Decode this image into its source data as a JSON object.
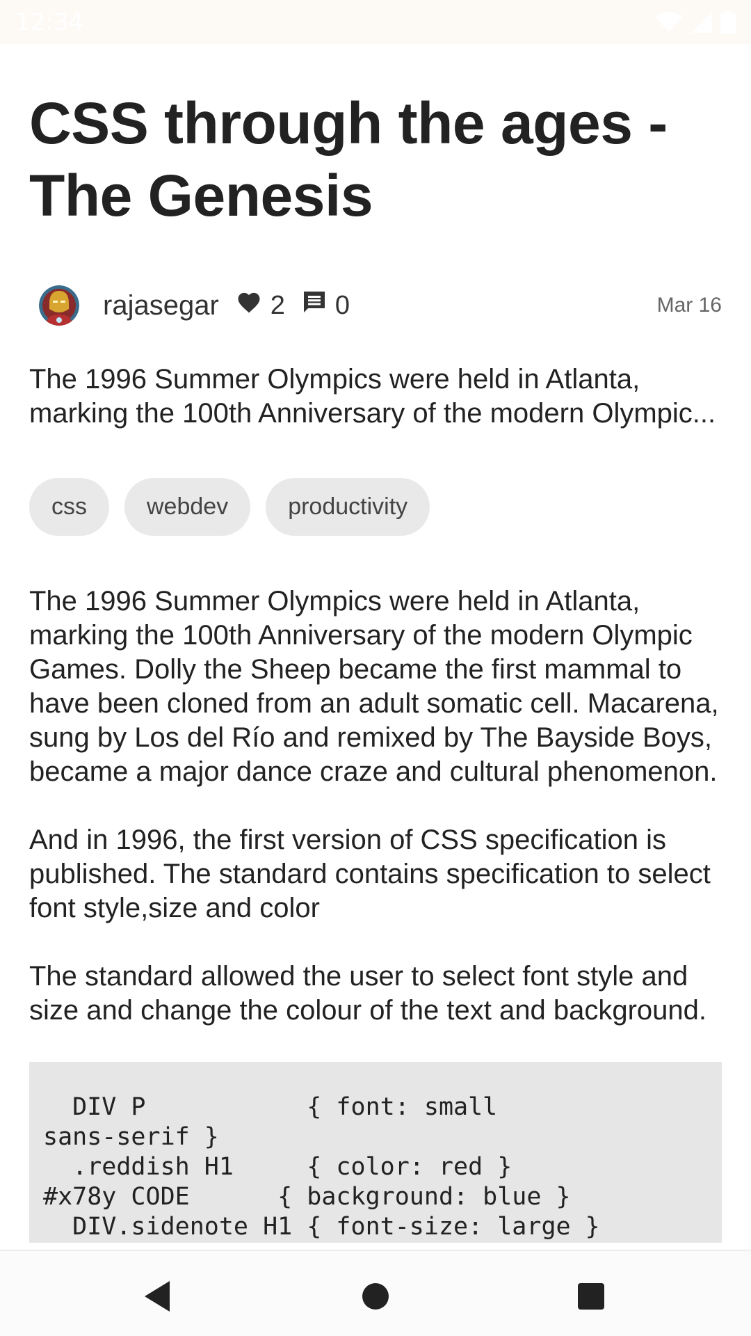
{
  "status_bar": {
    "time": "12:34",
    "icons": [
      "wifi-icon",
      "cellular-signal-icon",
      "battery-icon"
    ]
  },
  "article": {
    "title": "CSS through the ages - The Genesis",
    "author": "rajasegar",
    "likes": "2",
    "comments": "0",
    "date": "Mar 16",
    "excerpt": "The 1996 Summer Olympics were held in Atlanta, marking the 100th Anniversary of the modern Olympic...",
    "tags": [
      "css",
      "webdev",
      "productivity"
    ],
    "paragraphs": [
      "The 1996 Summer Olympics were held in Atlanta, marking the 100th Anniversary of the modern Olympic Games. Dolly the Sheep became the first mammal to have been cloned from an adult somatic cell. Macarena, sung by Los del Río and remixed by The Bayside Boys, became a major dance craze and cultural phenomenon.",
      "And in 1996, the first version of CSS specification is published. The standard contains specification to select font style,size and color",
      "The standard allowed the user to select font style and size and change the colour of the text and background."
    ],
    "code": "  DIV P           { font: small\nsans-serif }\n  .reddish H1     { color: red }\n#x78y CODE      { background: blue }\n  DIV.sidenote H1 { font-size: large }"
  },
  "nav_bar": {
    "buttons": [
      "back-icon",
      "home-icon",
      "recents-icon"
    ]
  },
  "colors": {
    "status_bar_bg": "#fdfaf6",
    "tag_bg": "#e9e9e9",
    "code_bg": "#e6e6e6",
    "text": "#222222"
  }
}
